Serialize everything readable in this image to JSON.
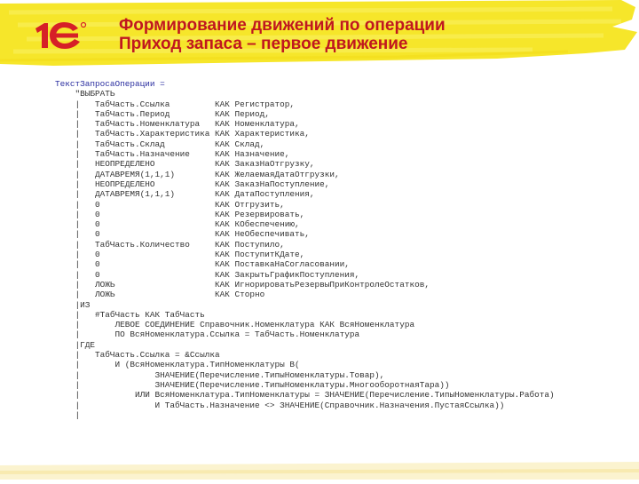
{
  "slide": {
    "title_line1": "Формирование движений по операции",
    "title_line2": "Приход запаса – первое движение"
  },
  "logo": {
    "text": "1С",
    "icon": "1c-logo-icon"
  },
  "colors": {
    "title": "#c0171f",
    "highlight": "#f6e62a",
    "logo_red": "#d62027",
    "code_text": "#333333",
    "first_line": "#2b2fa0"
  },
  "code_lines": [
    "ТекстЗапросаОперации =",
    "    \"ВЫБРАТЬ",
    "    |   ТабЧасть.Ссылка         КАК Регистратор,",
    "    |   ТабЧасть.Период         КАК Период,",
    "    |   ТабЧасть.Номенклатура   КАК Номенклатура,",
    "    |   ТабЧасть.Характеристика КАК Характеристика,",
    "    |   ТабЧасть.Склад          КАК Склад,",
    "    |   ТабЧасть.Назначение     КАК Назначение,",
    "    |   НЕОПРЕДЕЛЕНО            КАК ЗаказНаОтгрузку,",
    "    |   ДАТАВРЕМЯ(1,1,1)        КАК ЖелаемаяДатаОтгрузки,",
    "    |   НЕОПРЕДЕЛЕНО            КАК ЗаказНаПоступление,",
    "    |   ДАТАВРЕМЯ(1,1,1)        КАК ДатаПоступления,",
    "    |   0                       КАК Отгрузить,",
    "    |   0                       КАК Резервировать,",
    "    |   0                       КАК КОбеспечению,",
    "    |   0                       КАК НеОбеспечивать,",
    "    |   ТабЧасть.Количество     КАК Поступило,",
    "    |   0                       КАК ПоступитКДате,",
    "    |   0                       КАК ПоставкаНаСогласовании,",
    "    |   0                       КАК ЗакрытьГрафикПоступления,",
    "    |   ЛОЖЬ                    КАК ИгнорироватьРезервыПриКонтролеОстатков,",
    "    |   ЛОЖЬ                    КАК Сторно",
    "    |ИЗ",
    "    |   #ТабЧасть КАК ТабЧасть",
    "    |       ЛЕВОЕ СОЕДИНЕНИЕ Справочник.Номенклатура КАК ВсяНоменклатура",
    "    |       ПО ВсяНоменклатура.Ссылка = ТабЧасть.Номенклатура",
    "    |ГДЕ",
    "    |   ТабЧасть.Ссылка = &Ссылка",
    "    |       И (ВсяНоменклатура.ТипНоменклатуры В(",
    "    |               ЗНАЧЕНИЕ(Перечисление.ТипыНоменклатуры.Товар),",
    "    |               ЗНАЧЕНИЕ(Перечисление.ТипыНоменклатуры.МногооборотнаяТара))",
    "    |           ИЛИ ВсяНоменклатура.ТипНоменклатуры = ЗНАЧЕНИЕ(Перечисление.ТипыНоменклатуры.Работа)",
    "    |               И ТабЧасть.Назначение <> ЗНАЧЕНИЕ(Справочник.Назначения.ПустаяСсылка))",
    "    |"
  ]
}
